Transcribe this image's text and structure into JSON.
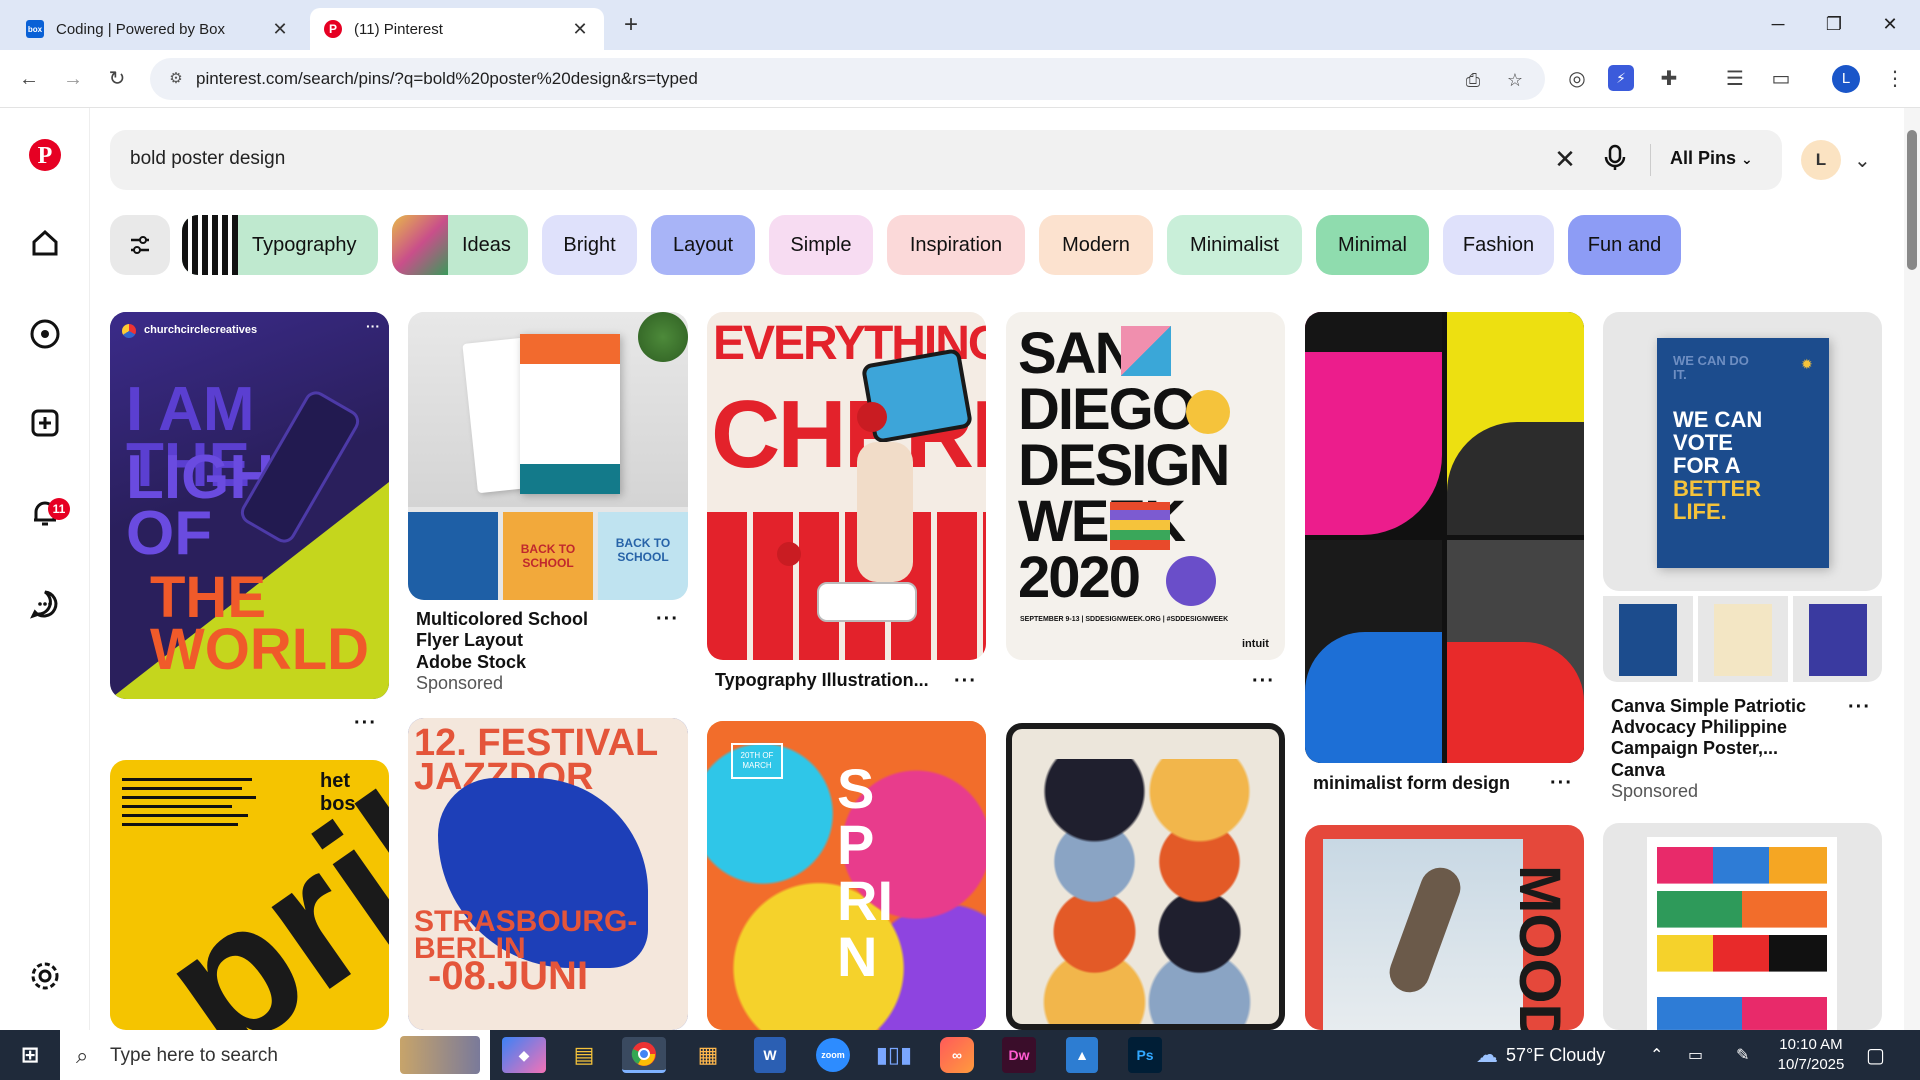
{
  "browser": {
    "tabs": [
      {
        "title": "Coding | Powered by Box",
        "favicon": "box-icon",
        "active": false
      },
      {
        "title": "(11) Pinterest",
        "favicon": "pinterest-icon",
        "active": true
      }
    ],
    "url": "pinterest.com/search/pins/?q=bold%20poster%20design&rs=typed",
    "profile_initial": "L"
  },
  "search": {
    "query": "bold poster design",
    "scope": "All Pins",
    "user_initial": "L"
  },
  "notifications": {
    "count": "11"
  },
  "chips": [
    {
      "label": "Typography",
      "bg": "#bfe9cf"
    },
    {
      "label": "Ideas",
      "bg": "#bfe9cf"
    },
    {
      "label": "Bright",
      "bg": "#dfe1fb"
    },
    {
      "label": "Layout",
      "bg": "#a8b4f7"
    },
    {
      "label": "Simple",
      "bg": "#f7dcf2"
    },
    {
      "label": "Inspiration",
      "bg": "#fbd9d9"
    },
    {
      "label": "Modern",
      "bg": "#fce2cf"
    },
    {
      "label": "Minimalist",
      "bg": "#c9efd9"
    },
    {
      "label": "Minimal",
      "bg": "#8fdcae"
    },
    {
      "label": "Fashion",
      "bg": "#dfe1fb"
    },
    {
      "label": "Fun and",
      "bg": "#8d9cf5"
    }
  ],
  "pins": {
    "p1": {
      "creator": "churchcirclecreatives",
      "poster_lines": [
        "I AM THE",
        "LIGHT OF",
        "THE WORLD"
      ]
    },
    "p2": {
      "title": "Multicolored School Flyer Layout",
      "source": "Adobe Stock",
      "sponsored": "Sponsored",
      "mini": [
        "BACK TO SCHOOL",
        "BACK TO SCHOOL"
      ]
    },
    "p3": {
      "title": "Typography Illustration...",
      "poster_lines": [
        "EVERYTHING'S",
        "CHERRY"
      ]
    },
    "p4": {
      "poster_lines": [
        "SAN",
        "DIEGO",
        "DESIGN",
        "WEEK",
        "2020"
      ],
      "footer": "SEPTEMBER 9-13 | SDDESIGNWEEK.ORG | #SDDESIGNWEEK",
      "brand": "intuit"
    },
    "p5": {
      "title": "minimalist form design"
    },
    "p6": {
      "title": "Canva Simple Patriotic Advocacy Philippine Campaign Poster,...",
      "source": "Canva",
      "sponsored": "Sponsored",
      "poster_lines": [
        "WE CAN",
        "VOTE",
        "FOR A",
        "BETTER",
        "LIFE."
      ],
      "header": "WE CAN DO IT."
    },
    "p7": {
      "brand": "het bos",
      "poster_lines": [
        "pril"
      ]
    },
    "p8": {
      "poster_lines": [
        "12. FESTIVAL JAZZDOR",
        "STRASBOURG-BERLIN",
        "-08.JUNI"
      ]
    },
    "p9": {
      "poster_lines": [
        "SPRIN"
      ],
      "badge": "20TH OF MARCH"
    },
    "p11": {
      "poster_lines": [
        "MOOD"
      ]
    }
  },
  "taskbar": {
    "search_placeholder": "Type here to search",
    "weather": "57°F  Cloudy",
    "time": "10:10 AM",
    "date": "10/7/2025"
  }
}
